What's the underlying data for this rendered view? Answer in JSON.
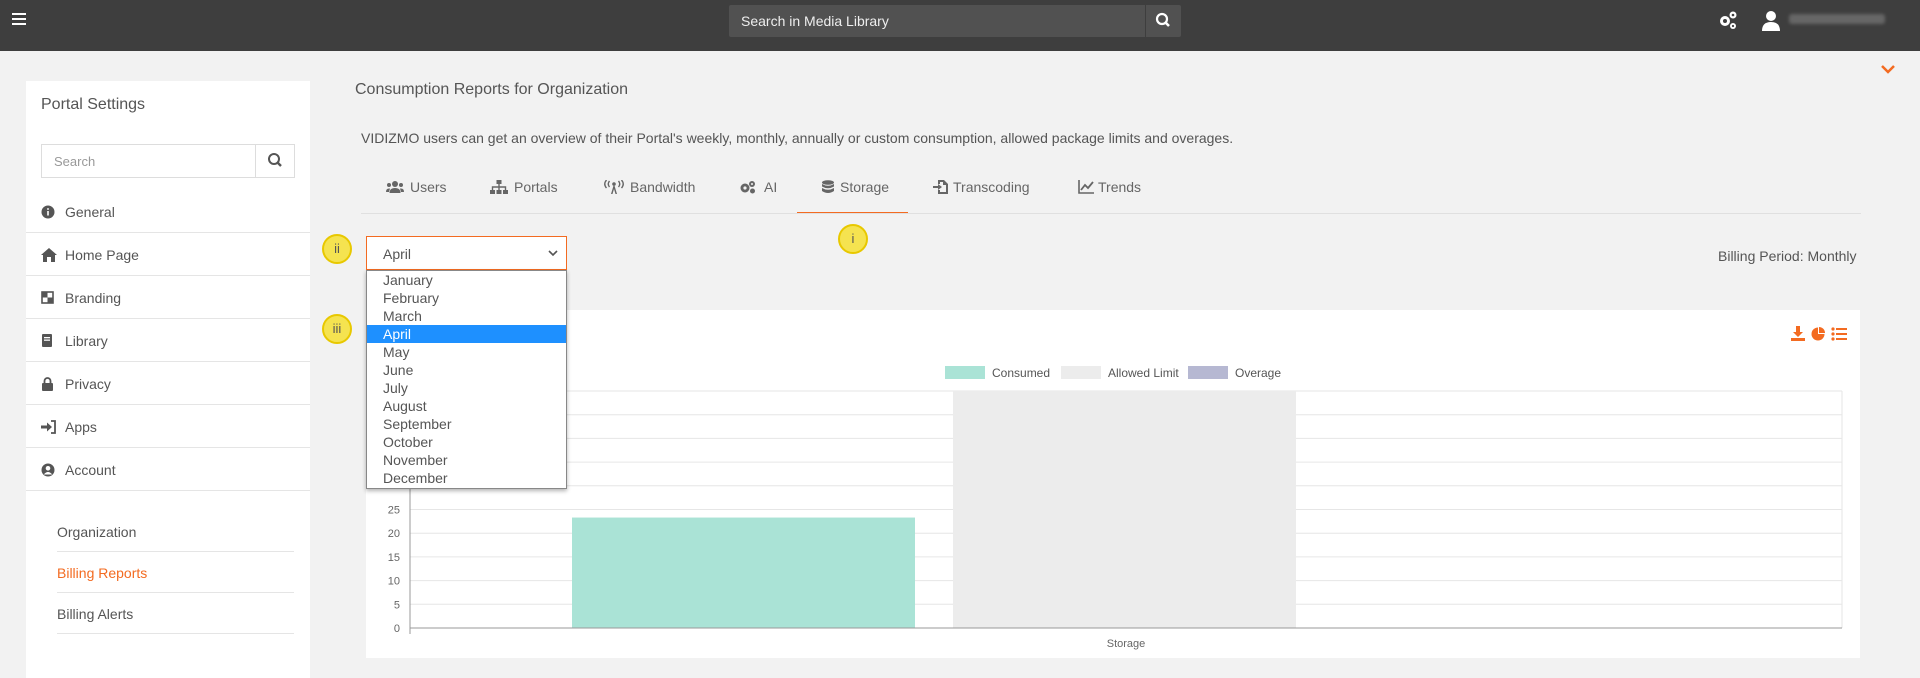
{
  "topbar": {
    "search_placeholder": "Search in Media Library",
    "icons": [
      "menu-icon",
      "search-icon",
      "gears-icon",
      "user-icon",
      "chevron-down-icon"
    ]
  },
  "sidebar": {
    "title": "Portal Settings",
    "search_placeholder": "Search",
    "items": [
      {
        "label": "General",
        "icon": "info-icon"
      },
      {
        "label": "Home Page",
        "icon": "home-icon"
      },
      {
        "label": "Branding",
        "icon": "branding-icon"
      },
      {
        "label": "Library",
        "icon": "book-icon"
      },
      {
        "label": "Privacy",
        "icon": "lock-icon"
      },
      {
        "label": "Apps",
        "icon": "sign-in-icon"
      },
      {
        "label": "Account",
        "icon": "user-circle-icon"
      }
    ],
    "subitems": [
      {
        "label": "Organization",
        "active": false
      },
      {
        "label": "Billing Reports",
        "active": true
      },
      {
        "label": "Billing Alerts",
        "active": false
      }
    ]
  },
  "main": {
    "title": "Consumption Reports for Organization",
    "description": "VIDIZMO users can get an overview of their Portal's weekly, monthly, annually or custom consumption, allowed package limits and overages.",
    "tabs": [
      {
        "label": "Users",
        "icon": "users-icon"
      },
      {
        "label": "Portals",
        "icon": "sitemap-icon"
      },
      {
        "label": "Bandwidth",
        "icon": "broadcast-icon"
      },
      {
        "label": "AI",
        "icon": "cogs-icon"
      },
      {
        "label": "Storage",
        "icon": "database-icon"
      },
      {
        "label": "Transcoding",
        "icon": "file-import-icon"
      },
      {
        "label": "Trends",
        "icon": "line-chart-icon"
      }
    ],
    "active_tab": "Storage",
    "month_select": {
      "value": "April",
      "options": [
        "January",
        "February",
        "March",
        "April",
        "May",
        "June",
        "July",
        "August",
        "September",
        "October",
        "November",
        "December"
      ]
    },
    "billing_period": "Billing Period:  Monthly",
    "badges": [
      "i",
      "ii",
      "iii"
    ],
    "accent_color": "#f36b21"
  },
  "chart_data": {
    "type": "bar",
    "categories": [
      "Storage"
    ],
    "series": [
      {
        "name": "Consumed",
        "values": [
          23.3
        ],
        "color": "#aae3d6"
      },
      {
        "name": "Allowed Limit",
        "values": [
          50
        ],
        "color": "#ececec"
      },
      {
        "name": "Overage",
        "values": [
          0
        ],
        "color": "#b6b8d2"
      }
    ],
    "ylim": [
      0,
      50
    ],
    "yticks": [
      0,
      5,
      10,
      15,
      20,
      25
    ],
    "grid": true,
    "legend": "top-center"
  }
}
